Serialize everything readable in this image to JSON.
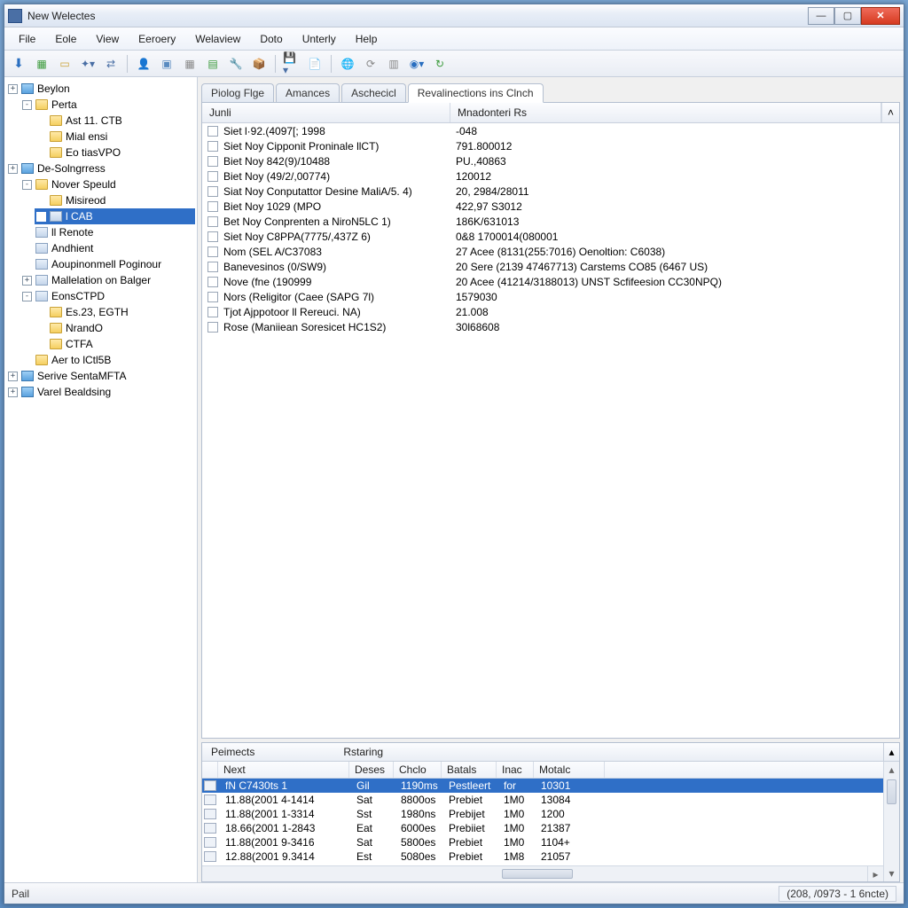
{
  "window": {
    "title": "New Welectes"
  },
  "menu": [
    "File",
    "Eole",
    "View",
    "Eeroery",
    "Welaview",
    "Doto",
    "Unterly",
    "Help"
  ],
  "tree": [
    {
      "exp": "+",
      "icon": "db",
      "label": "Beylon",
      "children": [
        {
          "exp": "-",
          "icon": "folder",
          "label": "Perta",
          "children": [
            {
              "exp": "",
              "icon": "folder",
              "label": "Ast 11. CTB"
            },
            {
              "exp": "",
              "icon": "folder",
              "label": "Mial ensi"
            },
            {
              "exp": "",
              "icon": "folder",
              "label": "Eo tiasVPO"
            }
          ]
        }
      ]
    },
    {
      "exp": "+",
      "icon": "db",
      "label": "De-Solngrress",
      "children": [
        {
          "exp": "-",
          "icon": "folder",
          "label": "Nover Speuld",
          "children": [
            {
              "exp": "",
              "icon": "folder",
              "label": "Misireod"
            },
            {
              "exp": "",
              "icon": "doc",
              "label": "l CAB",
              "sel": true
            }
          ]
        },
        {
          "exp": "",
          "icon": "doc",
          "label": "ll Renote"
        },
        {
          "exp": "",
          "icon": "doc",
          "label": "Andhient"
        },
        {
          "exp": "",
          "icon": "doc",
          "label": "Aoupinonmell Poginour"
        },
        {
          "exp": "+",
          "icon": "doc",
          "label": "Mallelation on Balger"
        },
        {
          "exp": "-",
          "icon": "doc",
          "label": "EonsCTPD",
          "children": [
            {
              "exp": "",
              "icon": "folder",
              "label": "Es.23, EGTH"
            },
            {
              "exp": "",
              "icon": "folder",
              "label": "NrandO"
            },
            {
              "exp": "",
              "icon": "folder",
              "label": "CTFA"
            }
          ]
        },
        {
          "exp": "",
          "icon": "folder",
          "label": "Aer to lCtl5B"
        }
      ]
    },
    {
      "exp": "+",
      "icon": "db",
      "label": "Serive SentaMFTA"
    },
    {
      "exp": "+",
      "icon": "db",
      "label": "Varel Bealdsing"
    }
  ],
  "tabs": [
    {
      "label": "Piolog Flge",
      "active": false
    },
    {
      "label": "Amances",
      "active": false
    },
    {
      "label": "Aschecicl",
      "active": false
    },
    {
      "label": "Revalinections ins Clnch",
      "active": true
    }
  ],
  "list": {
    "headers": {
      "c1": "Junli",
      "c2": "Mnadonteri Rs"
    },
    "rows": [
      {
        "c1": "Siet l·92.(4097[; 1998",
        "c2": "-048"
      },
      {
        "c1": "Siet Noy Cipponit Proninale llCT)",
        "c2": "791.800012"
      },
      {
        "c1": "Biet Noy 842(9)/10488",
        "c2": "PU.,40863"
      },
      {
        "c1": "Biet Noy (49/2/,00774)",
        "c2": "120012"
      },
      {
        "c1": "Siat Noy Conputattor Desine MaliA/5. 4)",
        "c2": "20, 2984/28011"
      },
      {
        "c1": "Biet Noy 1029 (MPO",
        "c2": "422,97 S3012"
      },
      {
        "c1": "Bet Noy Conprenten a NiroN5LC 1)",
        "c2": "186K/631013"
      },
      {
        "c1": "Siet Noy C8PPA(7775/,437Z 6)",
        "c2": "0&8 1700014(080001"
      },
      {
        "c1": "Nom (SEL A/C37083",
        "c2": "27 Acee (8131(255:7016) Oenoltion: C6038)"
      },
      {
        "c1": "Banevesinos (0/SW9)",
        "c2": "20 Sere (2139 47467713) Carstems CO85 (6467 US)"
      },
      {
        "c1": "Nove (fne (190999",
        "c2": "20 Acee (41214/3188013) UNST Scfifeesion CC30NPQ)"
      },
      {
        "c1": "Nors (Religitor (Caee (SAPG 7l)",
        "c2": "1579030"
      },
      {
        "c1": "Tjot Ajppotoor ll Rereuci. NA)",
        "c2": "21.008"
      },
      {
        "c1": "Rose (Maniiean Soresicet HC1S2)",
        "c2": "30l68608"
      }
    ]
  },
  "bottom": {
    "tabs": [
      "Peimects",
      "Rstaring"
    ],
    "headers": [
      "",
      "Next",
      "Deses",
      "Chclo",
      "Batals",
      "Inac",
      "Motalc"
    ],
    "widths": [
      18,
      148,
      50,
      54,
      62,
      42,
      80
    ],
    "rows": [
      {
        "sel": true,
        "cells": [
          "",
          "fN C7430ts   1",
          "Gil",
          "1190ms",
          "Pestleert",
          "for",
          "10301"
        ]
      },
      {
        "cells": [
          "",
          "11.88(2001 4-1414",
          "Sat",
          "8800os",
          "Prebiet",
          "1M0",
          "13084"
        ]
      },
      {
        "cells": [
          "",
          "11.88(2001 1-3314",
          "Sst",
          "1980ns",
          "Prebijet",
          "1M0",
          "1200"
        ]
      },
      {
        "cells": [
          "",
          "18.66(2001 1-2843",
          "Eat",
          "6000es",
          "Prebiiet",
          "1M0",
          "21387"
        ]
      },
      {
        "cells": [
          "",
          "11.88(2001 9-3416",
          "Sat",
          "5800es",
          "Prebiet",
          "1M0",
          "1104+"
        ]
      },
      {
        "cells": [
          "",
          "12.88(2001 9.3414",
          "Est",
          "5080es",
          "Prebiet",
          "1M8",
          "21057"
        ]
      }
    ]
  },
  "status": {
    "left": "Pail",
    "right": "(208, /0973 - 1 6ncte)"
  }
}
